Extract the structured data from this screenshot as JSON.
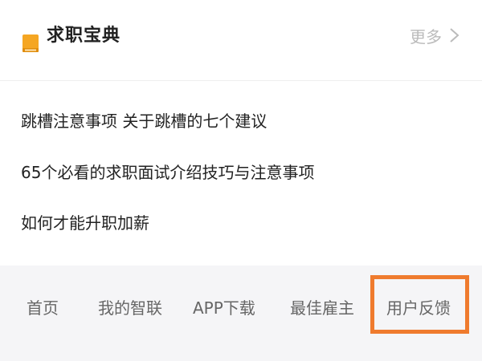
{
  "section": {
    "title": "求职宝典",
    "icon": "book-icon",
    "icon_color": "#f5a623",
    "more_label": "更多"
  },
  "articles": [
    {
      "title": "跳槽注意事项 关于跳槽的七个建议"
    },
    {
      "title": "65个必看的求职面试介绍技巧与注意事项"
    },
    {
      "title": "如何才能升职加薪"
    }
  ],
  "footer_nav": {
    "items": [
      {
        "label": "首页"
      },
      {
        "label": "我的智联"
      },
      {
        "label": "APP下载"
      },
      {
        "label": "最佳雇主"
      },
      {
        "label": "用户反馈"
      }
    ],
    "highlight_color": "#ef7b2e"
  }
}
